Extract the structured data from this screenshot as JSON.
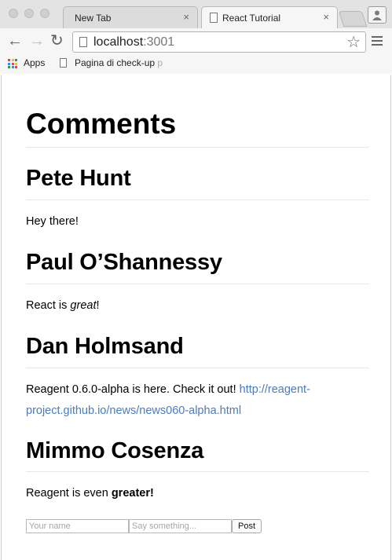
{
  "browser": {
    "tabs": [
      {
        "title": "New Tab",
        "close": "×",
        "active": false
      },
      {
        "title": "React Tutorial",
        "close": "×",
        "active": true
      }
    ],
    "nav": {
      "back": "←",
      "forward": "→",
      "reload": "↻"
    },
    "address": {
      "host": "localhost",
      "port": ":3001",
      "star": "☆"
    },
    "bookmarks": [
      {
        "label": "Apps",
        "icon": "apps-grid-icon"
      },
      {
        "label": "Pagina di check-up",
        "faded_tail": " p",
        "icon": "document-icon"
      }
    ],
    "apps_colors": [
      "#e8453c",
      "#f9bb2d",
      "#3a9a45",
      "#4285f4",
      "#e8453c",
      "#f9bb2d",
      "#3a9a45",
      "#4285f4",
      "#e8453c"
    ]
  },
  "page": {
    "title": "Comments",
    "comments": [
      {
        "author": "Pete Hunt",
        "text_parts": [
          "Hey there!"
        ]
      },
      {
        "author": "Paul O’Shannessy",
        "text_before": "React is ",
        "emphasis": "great",
        "text_after": "!"
      },
      {
        "author": "Dan Holmsand",
        "text_before": "Reagent 0.6.0-alpha is here. Check it out! ",
        "link": "http://reagent-project.github.io/news/news060-alpha.html"
      },
      {
        "author": "Mimmo Cosenza",
        "text_before": "Reagent is even ",
        "strong": "greater!"
      }
    ],
    "form": {
      "name_placeholder": "Your name",
      "text_placeholder": "Say something...",
      "post_label": "Post"
    },
    "link_color": "#4b7bbd"
  }
}
